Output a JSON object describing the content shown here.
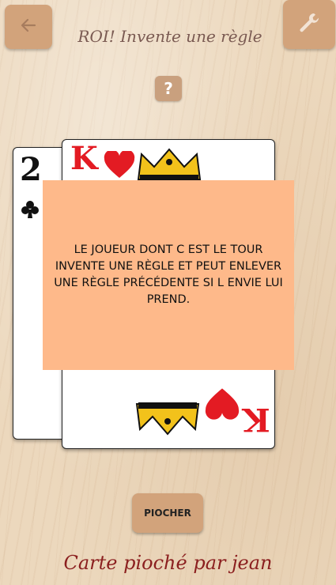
{
  "header": {
    "title": "ROI! Invente une règle",
    "back_icon": "arrow-left-icon",
    "settings_icon": "wrench-icon",
    "help_label": "?"
  },
  "cards": {
    "back_card": {
      "rank": "2",
      "suit": "clubs"
    },
    "front_card": {
      "rank": "K",
      "suit": "hearts"
    }
  },
  "rule": {
    "text": "LE JOUEUR DONT C EST LE TOUR INVENTE UNE RÈGLE ET PEUT ENLEVER UNE RÈGLE PRÉCÉDENTE SI L ENVIE LUI PREND."
  },
  "actions": {
    "draw_label": "PIOCHER"
  },
  "footer": {
    "drawn_by": "Carte pioché par jean"
  },
  "colors": {
    "button": "#d2a37b",
    "overlay": "#feb98a",
    "title": "#7a5a52",
    "footer": "#8b1f1f",
    "heart_red": "#e31b23"
  }
}
